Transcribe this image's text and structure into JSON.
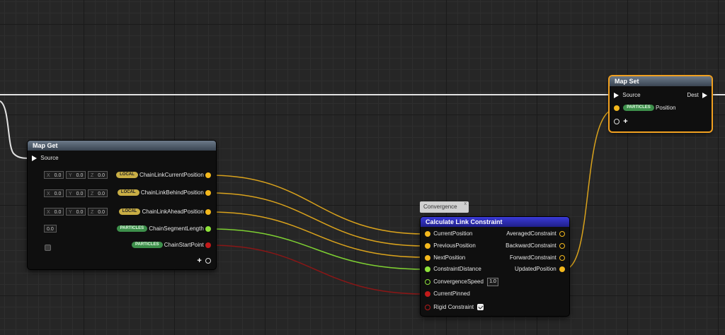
{
  "map_get": {
    "title": "Map Get",
    "source_label": "Source",
    "axis_x": "X",
    "axis_y": "Y",
    "axis_z": "Z",
    "outputs": [
      {
        "tag": "LOCAL",
        "label": "ChainLinkCurrentPosition",
        "x": "0.0",
        "y": "0.0",
        "z": "0.0"
      },
      {
        "tag": "LOCAL",
        "label": "ChainLinkBehindPosition",
        "x": "0.0",
        "y": "0.0",
        "z": "0.0"
      },
      {
        "tag": "LOCAL",
        "label": "ChainLinkAheadPosition",
        "x": "0.0",
        "y": "0.0",
        "z": "0.0"
      },
      {
        "tag": "PARTICLES",
        "label": "ChainSegmentLength",
        "value": "0.0"
      },
      {
        "tag": "PARTICLES",
        "label": "ChainStartPoint"
      }
    ],
    "add_pin": "+"
  },
  "map_set": {
    "title": "Map Set",
    "source_label": "Source",
    "dest_label": "Dest",
    "input_tag": "PARTICLES",
    "input_label": "Position",
    "add_pin": "+"
  },
  "comment": {
    "text": "Convergence",
    "close": "x"
  },
  "calc": {
    "title": "Calculate Link Constraint",
    "inputs": {
      "current_position": "CurrentPosition",
      "previous_position": "PreviousPosition",
      "next_position": "NextPosition",
      "constraint_distance": "ConstraintDistance",
      "convergence_speed": "ConvergenceSpeed",
      "convergence_speed_value": "1.0",
      "current_pinned": "CurrentPinned",
      "rigid_constraint": "Rigid Constraint"
    },
    "outputs": {
      "averaged": "AveragedConstraint",
      "backward": "BackwardConstraint",
      "forward": "ForwardConstraint",
      "updated": "UpdatedPosition"
    }
  },
  "colors": {
    "vector_pin": "#f3b81d",
    "float_pin": "#8fe33a",
    "bool_pin": "#c21a1a",
    "exec_wire": "#e6e6e6",
    "selected_border": "#f0a020"
  }
}
